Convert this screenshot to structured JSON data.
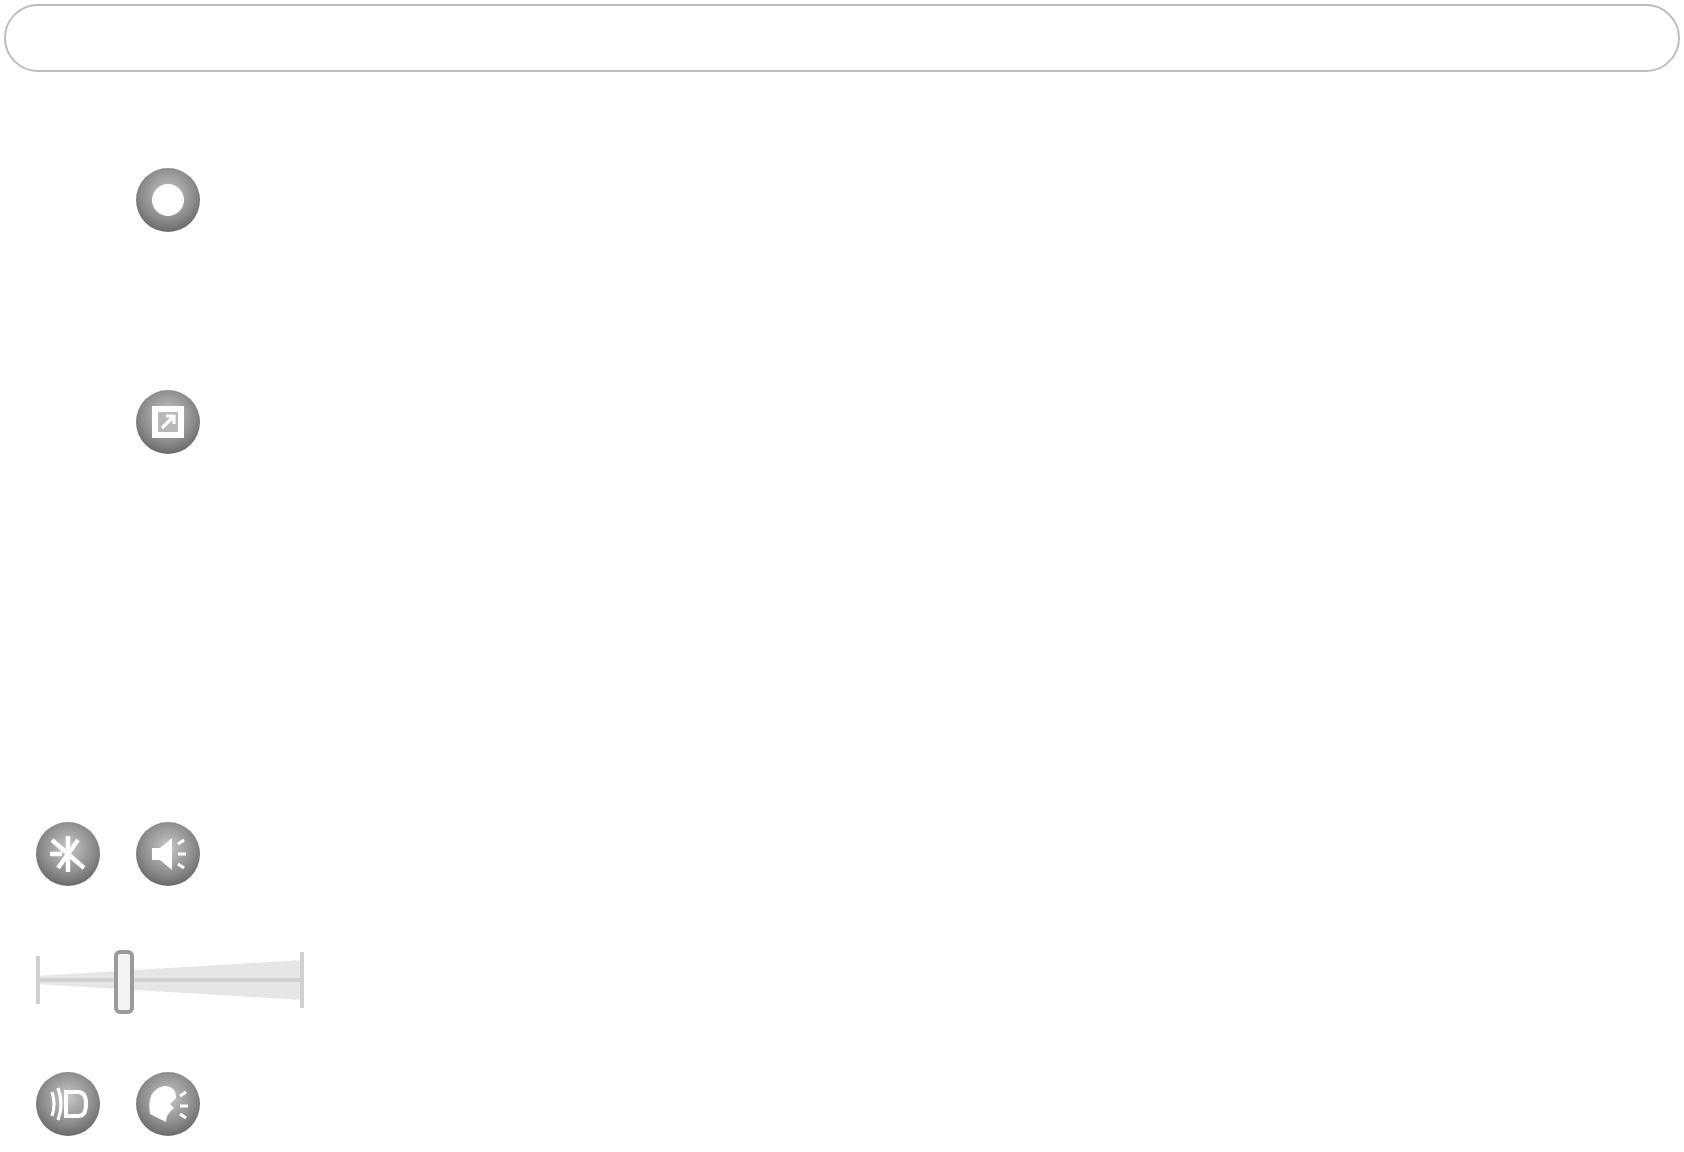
{
  "volume": {
    "level": 0.31
  }
}
